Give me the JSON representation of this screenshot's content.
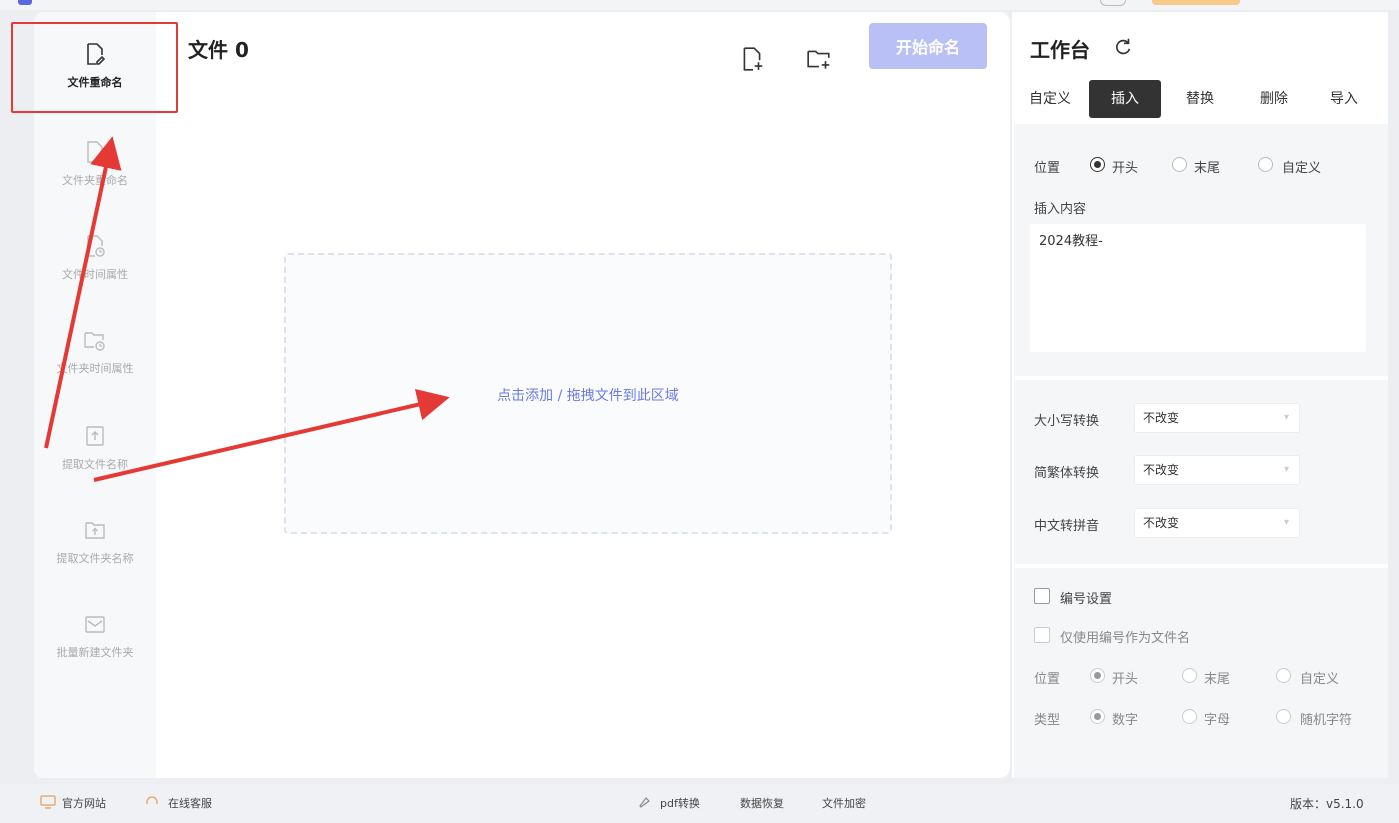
{
  "app": {
    "version_label": "版本：v5.1.0"
  },
  "sidebar": {
    "items": [
      {
        "label": "文件重命名",
        "icon": "file-edit-icon"
      },
      {
        "label": "文件夹重命名",
        "icon": "file-icon"
      },
      {
        "label": "文件时间属性",
        "icon": "file-clock-icon"
      },
      {
        "label": "文件夹时间属性",
        "icon": "folder-clock-icon"
      },
      {
        "label": "提取文件名称",
        "icon": "file-upload-icon"
      },
      {
        "label": "提取文件夹名称",
        "icon": "folder-upload-icon"
      },
      {
        "label": "批量新建文件夹",
        "icon": "folder-new-icon"
      }
    ]
  },
  "main": {
    "title": "文件 0",
    "add_file_icon": "add-file-icon",
    "add_folder_icon": "add-folder-icon",
    "start_button": "开始命名",
    "drop_text": "点击添加 / 拖拽文件到此区域"
  },
  "workbench": {
    "title": "工作台",
    "tabs": [
      "自定义",
      "插入",
      "替换",
      "删除",
      "导入"
    ],
    "active_tab": "插入",
    "position_label": "位置",
    "position_options": [
      "开头",
      "末尾",
      "自定义"
    ],
    "insert_content_label": "插入内容",
    "insert_content_value": "2024教程-",
    "case_label": "大小写转换",
    "case_value": "不改变",
    "trad_label": "简繁体转换",
    "trad_value": "不改变",
    "pinyin_label": "中文转拼音",
    "pinyin_value": "不改变",
    "numbering_label": "编号设置",
    "only_number_label": "仅使用编号作为文件名",
    "num_position_label": "位置",
    "num_position_options": [
      "开头",
      "末尾",
      "自定义"
    ],
    "type_label": "类型",
    "type_options": [
      "数字",
      "字母",
      "随机字符"
    ]
  },
  "footer": {
    "website": "官方网站",
    "support": "在线客服",
    "pdf": "pdf转换",
    "recovery": "数据恢复",
    "encrypt": "文件加密"
  },
  "colors": {
    "accent": "#b9c0f5",
    "drop_text": "#6b7be0",
    "annotation": "#e53935",
    "active_tab": "#333333"
  }
}
